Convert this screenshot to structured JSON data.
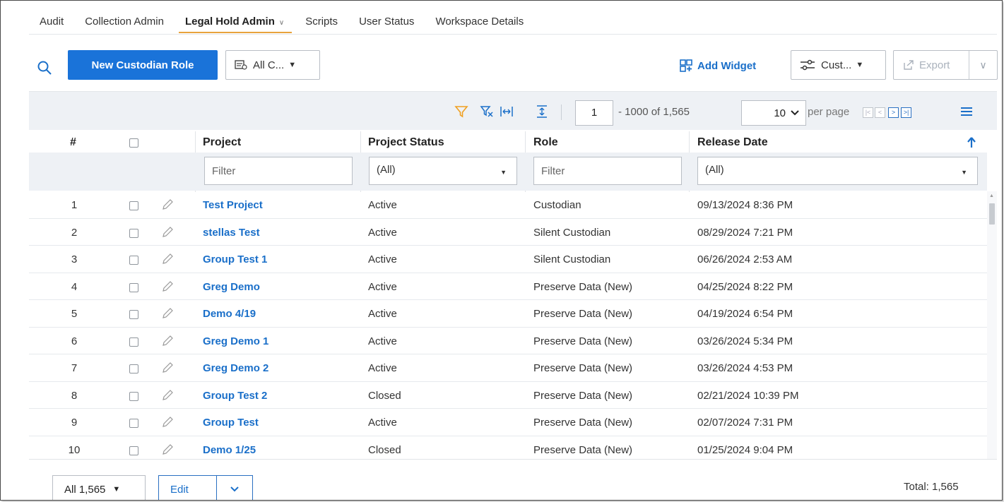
{
  "tabs": [
    {
      "label": "Audit"
    },
    {
      "label": "Collection Admin"
    },
    {
      "label": "Legal Hold Admin",
      "active": true
    },
    {
      "label": "Scripts"
    },
    {
      "label": "User Status"
    },
    {
      "label": "Workspace Details"
    }
  ],
  "toolbar": {
    "new_button": "New Custodian Role",
    "view_selector": "All C...",
    "add_widget": "Add Widget",
    "customize": "Cust...",
    "export": "Export"
  },
  "pagination": {
    "current_page": "1",
    "range_text": "- 1000  of 1,565",
    "per_page_value": "10",
    "per_page_label": "per page"
  },
  "columns": {
    "num": "#",
    "project": "Project",
    "project_status": "Project Status",
    "role": "Role",
    "release_date": "Release Date"
  },
  "filters": {
    "project_placeholder": "Filter",
    "status_value": "(All)",
    "role_placeholder": "Filter",
    "release_date_value": "(All)"
  },
  "rows": [
    {
      "num": "1",
      "project": "Test Project",
      "status": "Active",
      "role": "Custodian",
      "date": "09/13/2024 8:36 PM"
    },
    {
      "num": "2",
      "project": "stellas Test",
      "status": "Active",
      "role": "Silent Custodian",
      "date": "08/29/2024 7:21 PM"
    },
    {
      "num": "3",
      "project": "Group Test 1",
      "status": "Active",
      "role": "Silent Custodian",
      "date": "06/26/2024 2:53 AM"
    },
    {
      "num": "4",
      "project": "Greg Demo",
      "status": "Active",
      "role": "Preserve Data (New)",
      "date": "04/25/2024 8:22 PM"
    },
    {
      "num": "5",
      "project": "Demo 4/19",
      "status": "Active",
      "role": "Preserve Data (New)",
      "date": "04/19/2024 6:54 PM"
    },
    {
      "num": "6",
      "project": "Greg Demo 1",
      "status": "Active",
      "role": "Preserve Data (New)",
      "date": "03/26/2024 5:34 PM"
    },
    {
      "num": "7",
      "project": "Greg Demo 2",
      "status": "Active",
      "role": "Preserve Data (New)",
      "date": "03/26/2024 4:53 PM"
    },
    {
      "num": "8",
      "project": "Group Test 2",
      "status": "Closed",
      "role": "Preserve Data (New)",
      "date": "02/21/2024 10:39 PM"
    },
    {
      "num": "9",
      "project": "Group Test",
      "status": "Active",
      "role": "Preserve Data (New)",
      "date": "02/07/2024 7:31 PM"
    },
    {
      "num": "10",
      "project": "Demo 1/25",
      "status": "Closed",
      "role": "Preserve Data (New)",
      "date": "01/25/2024 9:04 PM"
    }
  ],
  "footer": {
    "select_all": "All 1,565",
    "edit": "Edit",
    "total": "Total: 1,565"
  },
  "colors": {
    "primary": "#1a73d9",
    "link": "#1a6fc9",
    "tab_underline": "#e8a33d",
    "filter_icon": "#f0a020"
  },
  "icons": {
    "search": "search-icon",
    "view": "view-list-icon",
    "add_widget": "widget-icon",
    "customize": "sliders-icon",
    "export": "export-icon",
    "filter": "filter-icon",
    "clear_filter": "clear-filter-icon",
    "fit_columns": "fit-columns-icon",
    "row_height": "row-height-icon",
    "sort": "sort-ascending-icon",
    "menu": "hamburger-menu-icon",
    "edit_row": "pencil-icon"
  }
}
